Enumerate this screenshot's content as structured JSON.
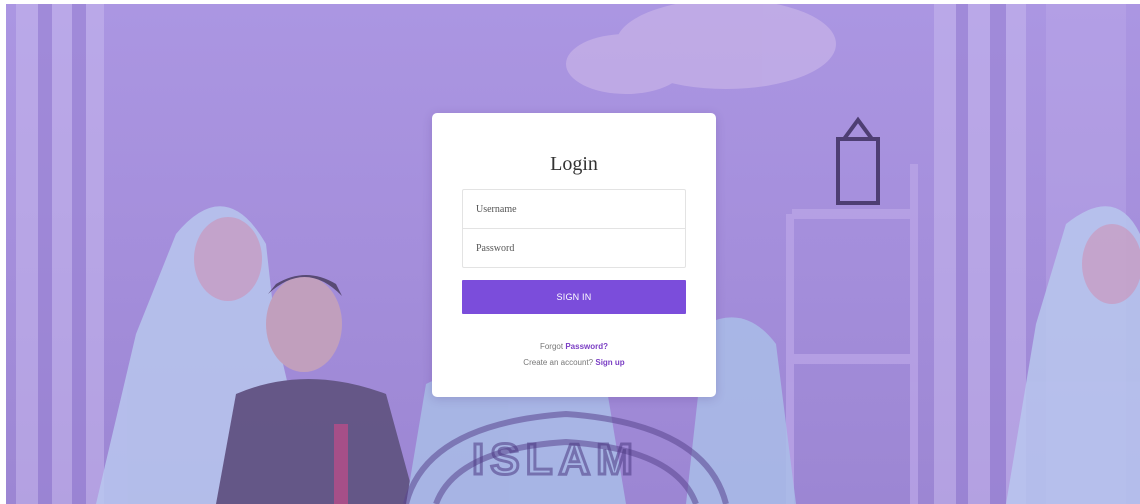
{
  "login": {
    "title": "Login",
    "username_placeholder": "Username",
    "password_placeholder": "Password",
    "signin_label": "SIGN IN",
    "forgot_prefix": "Forgot",
    "forgot_link": "Password?",
    "create_prefix": "Create an account?",
    "signup_link": "Sign up"
  },
  "background": {
    "watermark_text": "ISLAM",
    "overlay_color": "#a58fdc"
  },
  "colors": {
    "accent": "#7b4ddb",
    "link": "#7b3fc4"
  }
}
